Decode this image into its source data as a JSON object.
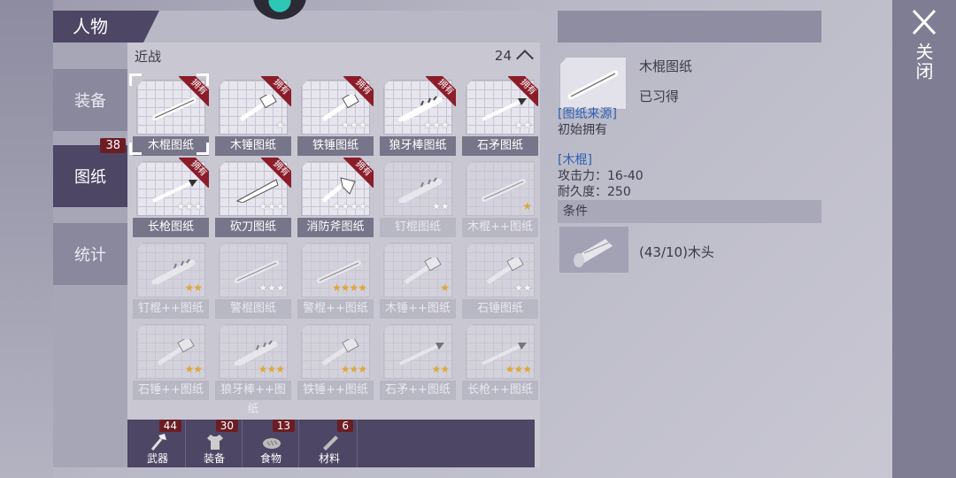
{
  "title": "人物",
  "sidebar": [
    {
      "label": "装备",
      "badge": ""
    },
    {
      "label": "图纸",
      "badge": "38",
      "active": true
    },
    {
      "label": "统计",
      "badge": ""
    }
  ],
  "section": {
    "name": "近战",
    "count": "24"
  },
  "ribbon_text": "拥有",
  "items": [
    {
      "label": "木棍图纸",
      "owned": true,
      "stars": "",
      "selected": true,
      "icon": "stick"
    },
    {
      "label": "木锤图纸",
      "owned": true,
      "stars": "w",
      "icon": "hammer"
    },
    {
      "label": "铁锤图纸",
      "owned": true,
      "stars": "www",
      "icon": "hammer"
    },
    {
      "label": "狼牙棒图纸",
      "owned": true,
      "stars": "www",
      "icon": "club"
    },
    {
      "label": "石矛图纸",
      "owned": true,
      "stars": "ww",
      "icon": "spear"
    },
    {
      "label": "长枪图纸",
      "owned": true,
      "stars": "www",
      "icon": "spear"
    },
    {
      "label": "砍刀图纸",
      "owned": true,
      "stars": "www",
      "icon": "blade"
    },
    {
      "label": "消防斧图纸",
      "owned": true,
      "stars": "wwww",
      "icon": "axe"
    },
    {
      "label": "钉棍图纸",
      "owned": false,
      "stars": "ww",
      "icon": "club"
    },
    {
      "label": "木棍++图纸",
      "owned": false,
      "stars": "g",
      "icon": "stick"
    },
    {
      "label": "钉棍++图纸",
      "owned": false,
      "stars": "gg",
      "icon": "club"
    },
    {
      "label": "警棍图纸",
      "owned": false,
      "stars": "www",
      "icon": "stick"
    },
    {
      "label": "警棍++图纸",
      "owned": false,
      "stars": "gggg",
      "icon": "stick"
    },
    {
      "label": "木锤++图纸",
      "owned": false,
      "stars": "g",
      "icon": "hammer"
    },
    {
      "label": "石锤图纸",
      "owned": false,
      "stars": "ww",
      "icon": "hammer"
    },
    {
      "label": "石锤++图纸",
      "owned": false,
      "stars": "gg",
      "icon": "hammer"
    },
    {
      "label": "狼牙棒++图纸",
      "owned": false,
      "stars": "ggg",
      "icon": "club"
    },
    {
      "label": "铁锤++图纸",
      "owned": false,
      "stars": "ggg",
      "icon": "hammer"
    },
    {
      "label": "石矛++图纸",
      "owned": false,
      "stars": "gg",
      "icon": "spear"
    },
    {
      "label": "长枪++图纸",
      "owned": false,
      "stars": "ggg",
      "icon": "spear"
    }
  ],
  "categories": [
    {
      "label": "武器",
      "badge": "44",
      "icon": "axe-icon"
    },
    {
      "label": "装备",
      "badge": "30",
      "icon": "shirt-icon"
    },
    {
      "label": "食物",
      "badge": "13",
      "icon": "bread-icon"
    },
    {
      "label": "材料",
      "badge": "6",
      "icon": "plank-icon"
    }
  ],
  "detail": {
    "name": "木棍图纸",
    "status": "已习得",
    "source_title": "[图纸来源]",
    "source_text": "初始拥有",
    "weapon_title": "[木棍]",
    "attack": "攻击力：16-40",
    "durability": "耐久度：250",
    "condition_title": "条件",
    "material_text": "(43/10)木头"
  },
  "close_label": "关闭"
}
